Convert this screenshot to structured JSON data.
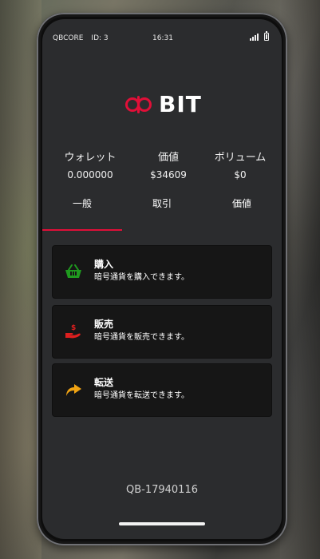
{
  "status": {
    "carrier": "QBCORE",
    "id": "ID: 3",
    "time": "16:31"
  },
  "logo": {
    "text": "BIT",
    "brand_color": "#e10f38"
  },
  "stats": [
    {
      "label": "ウォレット",
      "value": "0.000000"
    },
    {
      "label": "価値",
      "value": "$34609"
    },
    {
      "label": "ボリューム",
      "value": "$0"
    }
  ],
  "tabs": [
    {
      "label": "一般",
      "active": true
    },
    {
      "label": "取引",
      "active": false
    },
    {
      "label": "価値",
      "active": false
    }
  ],
  "actions": [
    {
      "title": "購入",
      "description": "暗号通貨を購入できます。",
      "icon": "basket-icon",
      "color": "#1f9b1f"
    },
    {
      "title": "販売",
      "description": "暗号通貨を販売できます。",
      "icon": "hand-money-icon",
      "color": "#dd1f1f"
    },
    {
      "title": "転送",
      "description": "暗号通貨を転送できます。",
      "icon": "share-arrow-icon",
      "color": "#f0a313"
    }
  ],
  "footer": {
    "account_id": "QB-17940116"
  }
}
